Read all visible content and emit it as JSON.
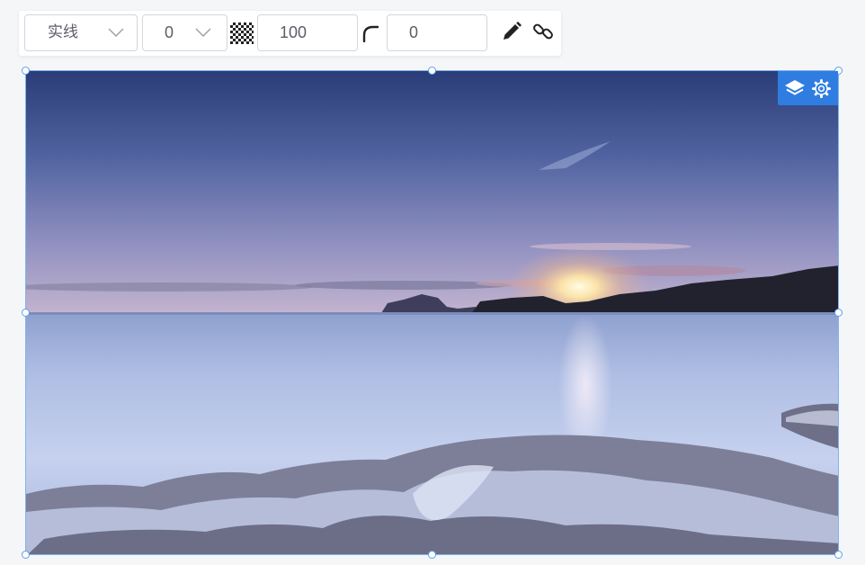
{
  "toolbar": {
    "border_style": {
      "value": "实线",
      "icon": "chevron-down-icon"
    },
    "border_width": {
      "value": "0",
      "icon": "chevron-down-icon"
    },
    "opacity": {
      "icon": "checkerboard-opacity-icon",
      "value": "100"
    },
    "corner_radius": {
      "icon": "corner-radius-icon",
      "value": "0"
    },
    "actions": [
      {
        "icon": "pencil-icon"
      },
      {
        "icon": "link-icon"
      }
    ]
  },
  "image": {
    "subject": "seascape-sunset-photo",
    "selected": true,
    "badge": {
      "color": "#2f7de1",
      "icons": [
        "layers-icon",
        "gear-icon"
      ]
    }
  },
  "colors": {
    "selection_border": "#7fb3f0",
    "handle_border": "#5d9ef0",
    "page_background": "#f5f6f8"
  }
}
